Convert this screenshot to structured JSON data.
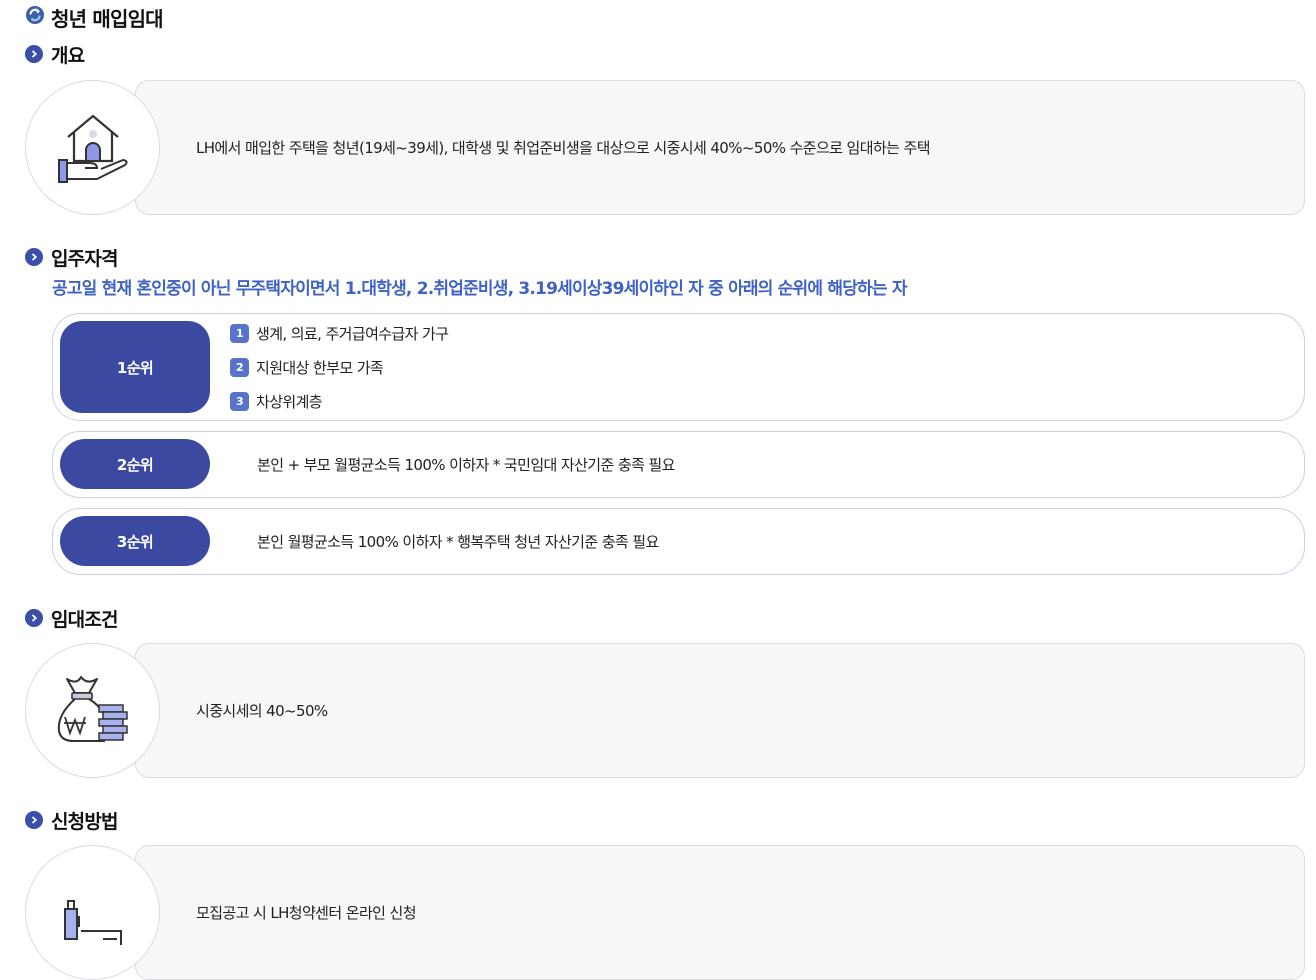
{
  "page": {
    "title": "청년 매입임대",
    "title_icon": "refresh-circle-icon"
  },
  "colors": {
    "primary": "#3b4aa0",
    "badge": "#3b4fa8",
    "highlight_text": "#3f63c4",
    "number_badge": "#5873c9",
    "box_bg": "#f7f7f8",
    "border": "#d9dbe1",
    "rank_border": "#c9cfe8"
  },
  "overview": {
    "heading": "개요",
    "icon": "house-in-hand-icon",
    "text": "LH에서 매입한 주택을 청년(19세~39세), 대학생 및 취업준비생을 대상으로 시중시세 40%~50% 수준으로 임대하는 주택"
  },
  "eligibility": {
    "heading": "입주자격",
    "summary": "공고일 현재 혼인중이 아닌 무주택자이면서 1.대학생, 2.취업준비생, 3.19세이상39세이하인 자 중 아래의 순위에 해당하는 자",
    "ranks": [
      {
        "label": "1순위",
        "items": [
          {
            "num": "1",
            "text": "생계, 의료, 주거급여수급자 가구"
          },
          {
            "num": "2",
            "text": "지원대상 한부모 가족"
          },
          {
            "num": "3",
            "text": "차상위계층"
          }
        ]
      },
      {
        "label": "2순위",
        "text": "본인 + 부모 월평균소득 100% 이하자 * 국민임대 자산기준 충족 필요"
      },
      {
        "label": "3순위",
        "text": "본인 월평균소득 100% 이하자 * 행복주택 청년 자산기준 충족 필요"
      }
    ]
  },
  "rent_terms": {
    "heading": "임대조건",
    "icon": "money-bag-won-icon",
    "text": "시중시세의 40~50%"
  },
  "application": {
    "heading": "신청방법",
    "icon": "pen-document-icon",
    "text": "모집공고 시 LH청약센터 온라인 신청"
  }
}
